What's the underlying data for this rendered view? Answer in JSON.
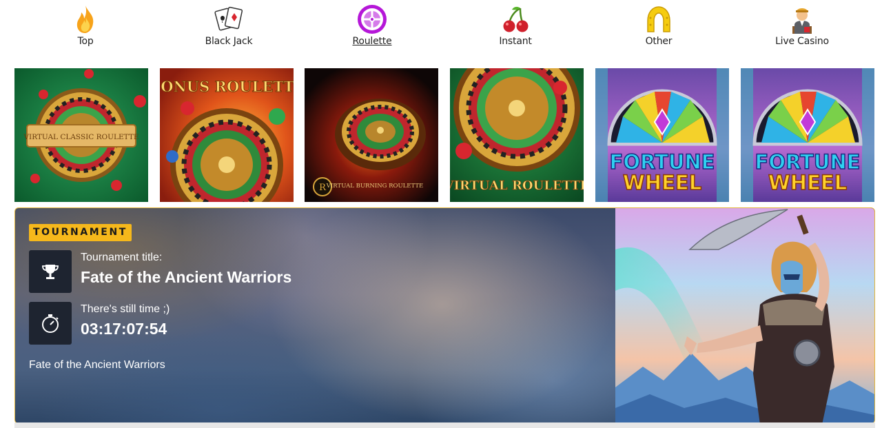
{
  "categories": [
    {
      "label": "Top",
      "icon": "flame-icon",
      "active": false
    },
    {
      "label": "Black Jack",
      "icon": "playing-cards-icon",
      "active": false
    },
    {
      "label": "Roulette",
      "icon": "roulette-icon",
      "active": true
    },
    {
      "label": "Instant",
      "icon": "cherries-icon",
      "active": false
    },
    {
      "label": "Other",
      "icon": "horseshoe-icon",
      "active": false
    },
    {
      "label": "Live Casino",
      "icon": "dealer-icon",
      "active": false
    }
  ],
  "games": [
    {
      "title": "VIRTUAL CLASSIC ROULETTE",
      "theme": "green"
    },
    {
      "title": "BONUS ROULETTE",
      "theme": "orange"
    },
    {
      "title": "VIRTUAL BURNING ROULETTE",
      "theme": "dark-red"
    },
    {
      "title": "VIRTUAL ROULETTE",
      "theme": "green-gold"
    },
    {
      "title_line1": "FORTUNE",
      "title_line2": "WHEEL",
      "theme": "purple"
    },
    {
      "title_line1": "FORTUNE",
      "title_line2": "WHEEL",
      "theme": "purple"
    }
  ],
  "tournament": {
    "badge": "TOURNAMENT",
    "title_label": "Tournament title:",
    "title": "Fate of the Ancient Warriors",
    "timer_label": "There's still time ;)",
    "countdown": "03:17:07:54",
    "description": "Fate of the Ancient Warriors"
  },
  "colors": {
    "badge": "#f6b81b",
    "border": "#e2b53a",
    "icon_box": "#1e2430",
    "roulette_active": "#b517d8"
  }
}
